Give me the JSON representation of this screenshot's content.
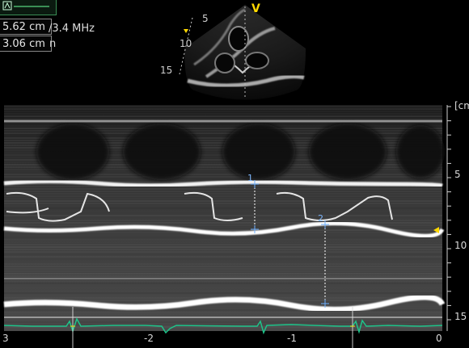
{
  "measurements": [
    {
      "index": "1",
      "value": "5.62 cm"
    },
    {
      "index": "2",
      "value": "3.06 cm"
    }
  ],
  "probe": {
    "frequency": "/3.4 MHz",
    "unit_fragment": "n"
  },
  "sector_view": {
    "mode_marker": "V",
    "depth_labels": [
      "5",
      "10",
      "15"
    ]
  },
  "mmode": {
    "depth_unit": "[cm",
    "depth_scale": [
      "5",
      "10",
      "15"
    ],
    "time_scale": [
      "3",
      "-2",
      "-1",
      "0"
    ],
    "calipers": [
      "1",
      "2"
    ]
  },
  "colors": {
    "ecg": "#1ec48a",
    "caliper": "#6fb0ff",
    "marker": "#ffd800",
    "status_green": "#3a8f55"
  }
}
